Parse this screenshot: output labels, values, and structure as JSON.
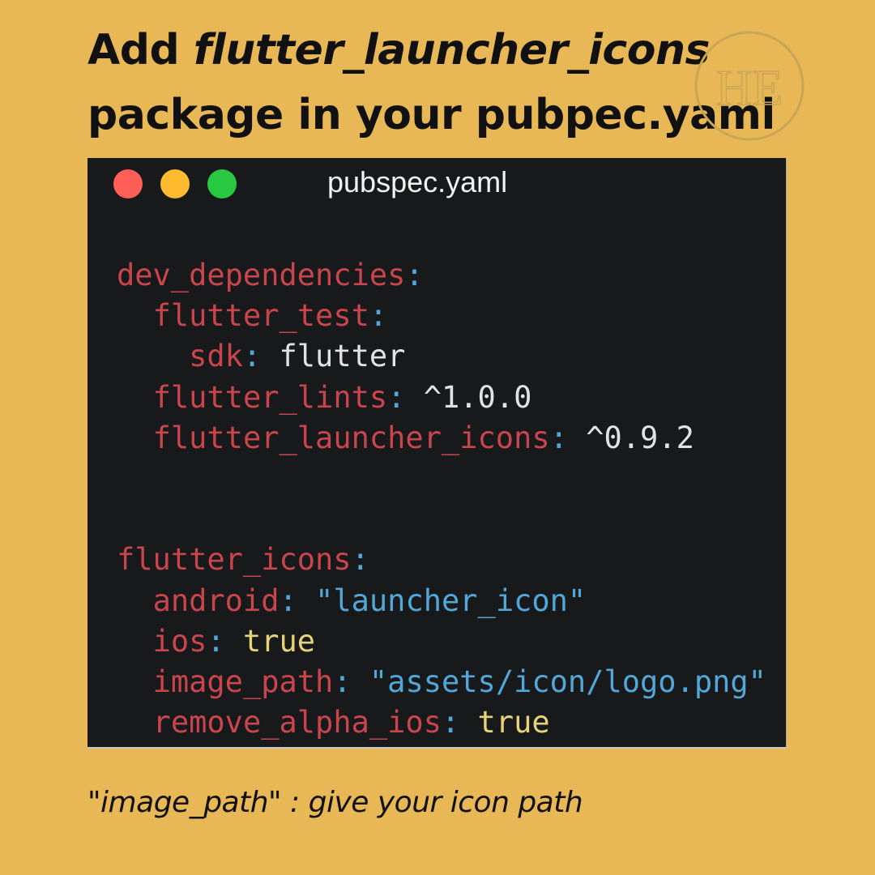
{
  "header": {
    "title_prefix": "Add ",
    "title_package": "flutter_launcher_icons",
    "title_line2": "package in your pubpec.yaml"
  },
  "watermark": {
    "text": "HE"
  },
  "window": {
    "title": "pubspec.yaml",
    "controls": [
      "close",
      "minimize",
      "maximize"
    ]
  },
  "code": {
    "dev_dependencies": "dev_dependencies",
    "flutter_test": "flutter_test",
    "sdk_key": "sdk",
    "sdk_value": "flutter",
    "flutter_lints": "flutter_lints",
    "flutter_lints_version": "^1.0.0",
    "flutter_launcher_icons": "flutter_launcher_icons",
    "flutter_launcher_icons_version": "^0.9.2",
    "flutter_icons": "flutter_icons",
    "android_key": "android",
    "android_value": "\"launcher_icon\"",
    "ios_key": "ios",
    "ios_value": "true",
    "image_path_key": "image_path",
    "image_path_value": "\"assets/icon/logo.png\"",
    "remove_alpha_ios_key": "remove_alpha_ios",
    "remove_alpha_ios_value": "true"
  },
  "caption": "\"image_path\" : give your icon path",
  "colors": {
    "background": "#E8B856",
    "editor": "#18191B",
    "key": "#C9454D",
    "punct": "#52A7D9",
    "string": "#52A7D9",
    "bool": "#E5D37A"
  }
}
